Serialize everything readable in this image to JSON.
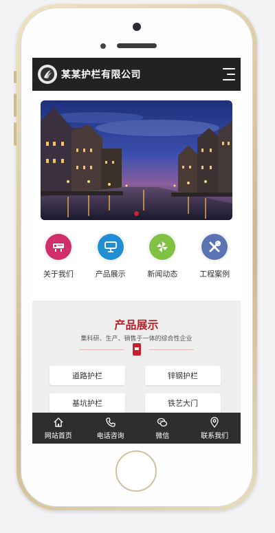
{
  "header": {
    "title": "某某护栏有限公司"
  },
  "banner": {
    "slides": 1
  },
  "quick_links": [
    {
      "label": "关于我们",
      "icon": "router-icon",
      "color": "#d12e6a"
    },
    {
      "label": "产品展示",
      "icon": "monitor-icon",
      "color": "#1f8ed3"
    },
    {
      "label": "新闻动态",
      "icon": "pinwheel-icon",
      "color": "#7fc142"
    },
    {
      "label": "工程案例",
      "icon": "tools-icon",
      "color": "#5a73b3"
    }
  ],
  "products_section": {
    "title": "产品展示",
    "subtitle": "集科研、生产、销售于一体的综合性企业",
    "items": [
      "道路护栏",
      "锌钢护栏",
      "基坑护栏",
      "铁艺大门"
    ]
  },
  "footer": {
    "items": [
      {
        "label": "网站首页",
        "icon": "home-icon"
      },
      {
        "label": "电话咨询",
        "icon": "phone-icon"
      },
      {
        "label": "微信",
        "icon": "wechat-icon"
      },
      {
        "label": "联系我们",
        "icon": "location-icon"
      }
    ]
  },
  "colors": {
    "accent": "#b8232a",
    "header_bg": "#222222",
    "footer_bg": "#2e2e2e"
  }
}
